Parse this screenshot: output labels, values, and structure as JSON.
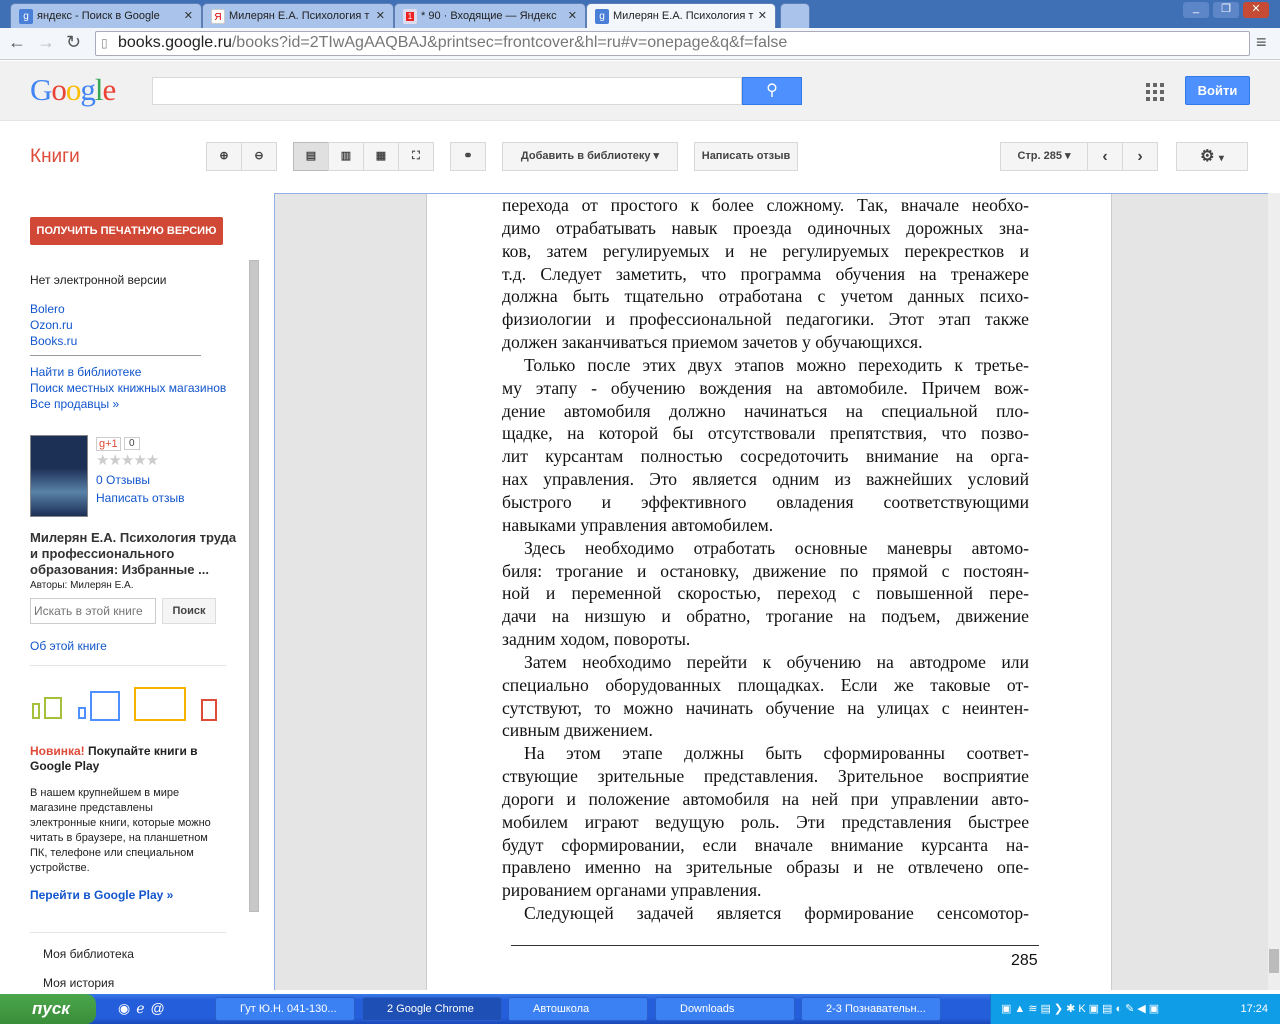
{
  "browser": {
    "tabs": [
      {
        "title": "яндекс - Поиск в Google",
        "icon": "google-icon"
      },
      {
        "title": "Милерян Е.А. Психология т",
        "icon": "yandex-icon"
      },
      {
        "title": "* 90 · Входящие — Яндекс",
        "icon": "mail-icon",
        "badge": "1"
      },
      {
        "title": "Милерян Е.А. Психология т",
        "icon": "google-icon",
        "active": true
      }
    ],
    "url_host": "books.google.ru",
    "url_path": "/books?id=2TIwAgAAQBAJ&printsec=frontcover&hl=ru#v=onepage&q&f=false"
  },
  "header": {
    "logo": "Google",
    "search_value": "",
    "signin": "Войти"
  },
  "toolbar": {
    "title": "Книги",
    "add_library": "Добавить в библиотеку",
    "write_review": "Написать отзыв",
    "page_select": "Стр. 285"
  },
  "sidebar": {
    "get_print": "ПОЛУЧИТЬ ПЕЧАТНУЮ ВЕРСИЮ",
    "no_ebook": "Нет электронной версии",
    "sellers": [
      "Bolero",
      "Ozon.ru",
      "Books.ru"
    ],
    "links": [
      "Найти в библиотеке",
      "Поиск местных книжных магазинов",
      "Все продавцы »"
    ],
    "gplus": "+1",
    "gplus_count": "0",
    "rating": 0,
    "reviews": "0 Отзывы",
    "write_review": "Написать отзыв",
    "book_title": "Милерян Е.А. Психология труда и профессионального образования: Избранные ...",
    "authors": "Авторы: Милерян Е.А.",
    "search_placeholder": "Искать в этой книге",
    "search_btn": "Поиск",
    "about": "Об этой книге",
    "promo_new": "Новинка!",
    "promo_head": " Покупайте книги в Google Play",
    "promo_text": "В нашем крупнейшем в мире магазине представлены электронные книги, которые можно читать в браузере, на планшетном ПК, телефоне или специальном устройстве.",
    "promo_link": "Перейти в Google Play »",
    "my_library": "Моя библиотека",
    "my_history": "Моя история"
  },
  "book_page": {
    "paragraphs": [
      {
        "indent": false,
        "lines": [
          "перехода от простого к более сложному. Так, вначале необхо-",
          "димо отрабатывать навык проезда одиночных дорожных зна-",
          "ков, затем регулируемых и не регулируемых перекрестков и",
          "т.д. Следует заметить, что программа обучения на тренажере",
          "должна быть тщательно отработана с учетом данных психо-",
          "физиологии и профессиональной педагогики. Этот этап также",
          "должен заканчиваться приемом зачетов у обучающихся."
        ]
      },
      {
        "indent": true,
        "lines": [
          "Только после этих двух этапов можно переходить к третье-",
          "му этапу - обучению вождения на автомобиле. Причем вож-",
          "дение автомобиля должно начинаться на специальной пло-",
          "щадке, на которой бы отсутствовали препятствия, что позво-",
          "лит курсантам полностью сосредоточить внимание на орга-",
          "нах управления. Это является одним из важнейших условий",
          "быстрого и эффективного овладения соответствующими",
          "навыками управления автомобилем."
        ]
      },
      {
        "indent": true,
        "lines": [
          "Здесь необходимо отработать основные маневры автомо-",
          "биля: трогание и остановку, движение по прямой с постоян-",
          "ной и переменной скоростью, переход с повышенной пере-",
          "дачи на низшую и обратно, трогание на подъем,  движение",
          "задним ходом, повороты."
        ]
      },
      {
        "indent": true,
        "lines": [
          "Затем необходимо перейти к обучению на автодроме или",
          "специально оборудованных площадках. Если же таковые от-",
          "сутствуют, то можно начинать обучение на улицах с неинтен-",
          "сивным движением."
        ]
      },
      {
        "indent": true,
        "lines": [
          "На этом этапе должны быть сформированны соответ-",
          "ствующие зрительные представления. Зрительное восприятие",
          "дороги и положение автомобиля на ней при управлении авто-",
          "мобилем играют ведущую роль. Эти представления быстрее",
          "будут сформировании, если вначале внимание курсанта на-",
          "правлено именно на зрительные образы и не отвлечено опе-",
          "рированием органами управления."
        ]
      },
      {
        "indent": true,
        "continues": true,
        "lines": [
          "Следующей задачей является формирование сенсомотор-"
        ]
      }
    ],
    "page_number": "285"
  },
  "taskbar": {
    "start": "пуск",
    "tasks": [
      "Гут Ю.Н. 041-130...",
      "2 Google Chrome",
      "Автошкола",
      "Downloads",
      "2-3 Познавательн..."
    ],
    "clock": "17:24"
  },
  "colors": {
    "accent": "#4d90fe",
    "books_red": "#dd4b39",
    "link": "#1155cc"
  }
}
